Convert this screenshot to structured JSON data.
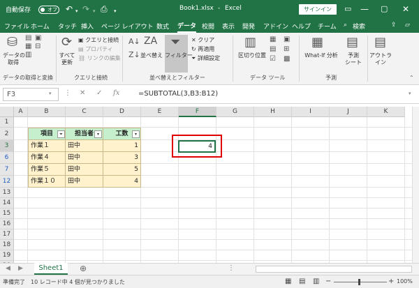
{
  "titlebar": {
    "autosave_label": "自動保存",
    "autosave_state": "オフ",
    "filename": "Book1.xlsx",
    "separator": "-",
    "app": "Excel",
    "signin": "サインイン"
  },
  "tabs": [
    "ファイル",
    "ホーム",
    "タッチ",
    "挿入",
    "ページ レイアウト",
    "数式",
    "データ",
    "校閲",
    "表示",
    "開発",
    "アドイン",
    "ヘルプ",
    "チーム"
  ],
  "active_tab": "データ",
  "search_label": "検索",
  "ribbon": {
    "get_data": "データの",
    "get_data2": "取得",
    "refresh_all": "すべて",
    "refresh_all2": "更新",
    "queries": "クエリと接続",
    "properties": "プロパティ",
    "edit_links": "リンクの編集",
    "sort": "並べ替え",
    "filter": "フィルター",
    "clear": "クリア",
    "reapply": "再適用",
    "advanced": "詳細設定",
    "text_to_columns": "区切り位置",
    "what_if": "What-If 分析",
    "forecast": "予測",
    "forecast2": "シート",
    "outline": "アウトラ",
    "outline2": "イン",
    "groups": {
      "get_transform": "データの取得と変換",
      "queries": "クエリと接続",
      "sort_filter": "並べ替えとフィルター",
      "data_tools": "データ ツール",
      "forecast": "予測"
    }
  },
  "formula_bar": {
    "name_box": "F3",
    "formula": "=SUBTOTAL(3,B3:B12)"
  },
  "columns": [
    "A",
    "B",
    "C",
    "D",
    "E",
    "F",
    "G",
    "H",
    "I",
    "J",
    "K"
  ],
  "rows": [
    "1",
    "2",
    "3",
    "6",
    "7",
    "12",
    "13",
    "14",
    "15",
    "16",
    "17",
    "18",
    "19",
    "20"
  ],
  "table": {
    "headers": [
      "項目",
      "担当者",
      "工数"
    ],
    "rows": [
      [
        "作業１",
        "田中",
        "1"
      ],
      [
        "作業４",
        "田中",
        "3"
      ],
      [
        "作業５",
        "田中",
        "5"
      ],
      [
        "作業１０",
        "田中",
        "4"
      ]
    ]
  },
  "result_cell": "4",
  "sheet_tab": "Sheet1",
  "status": {
    "left": "準備完了　10 レコード中 4 個が見つかりました",
    "zoom": "100%"
  },
  "colors": {
    "accent": "#217346",
    "highlight": "#e00000",
    "header_fill": "#c6efce",
    "data_fill": "#fff2cc"
  }
}
